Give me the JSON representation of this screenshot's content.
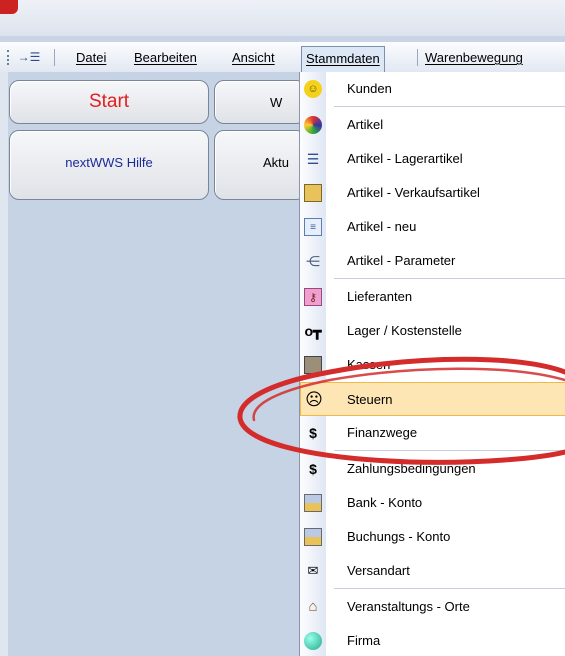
{
  "menubar": {
    "items": [
      {
        "label": "Datei"
      },
      {
        "label": "Bearbeiten"
      },
      {
        "label": "Ansicht"
      },
      {
        "label": "Stammdaten"
      },
      {
        "label": "Warenbewegung"
      }
    ]
  },
  "tiles": {
    "start": "Start",
    "w": "W",
    "help": "nextWWS Hilfe",
    "akt": "Aktu"
  },
  "colors": {
    "start_text": "#e02020",
    "help_text": "#1a2a9a",
    "highlight": "#fde6b3",
    "annotation": "#d42b2b"
  },
  "dropdown": {
    "items": [
      {
        "label": "Kunden",
        "icon": "smiley-icon"
      },
      {
        "label": "Artikel",
        "icon": "palette-icon"
      },
      {
        "label": "Artikel - Lagerartikel",
        "icon": "list-icon"
      },
      {
        "label": "Artikel - Verkaufsartikel",
        "icon": "register-icon"
      },
      {
        "label": "Artikel - neu",
        "icon": "form-icon"
      },
      {
        "label": "Artikel - Parameter",
        "icon": "tree-icon"
      },
      {
        "label": "Lieferanten",
        "icon": "key-card-icon"
      },
      {
        "label": "Lager / Kostenstelle",
        "icon": "key-icon"
      },
      {
        "label": "Kassen",
        "icon": "cash-register-icon"
      },
      {
        "label": "Steuern",
        "icon": "sad-face-icon"
      },
      {
        "label": "Finanzwege",
        "icon": "dollar-icon"
      },
      {
        "label": "Zahlungsbedingungen",
        "icon": "dollar-icon"
      },
      {
        "label": "Bank - Konto",
        "icon": "coins-icon"
      },
      {
        "label": "Buchungs - Konto",
        "icon": "coins-icon"
      },
      {
        "label": "Versandart",
        "icon": "envelopes-icon"
      },
      {
        "label": "Veranstaltungs - Orte",
        "icon": "house-icon"
      },
      {
        "label": "Firma",
        "icon": "globe-icon"
      }
    ]
  }
}
